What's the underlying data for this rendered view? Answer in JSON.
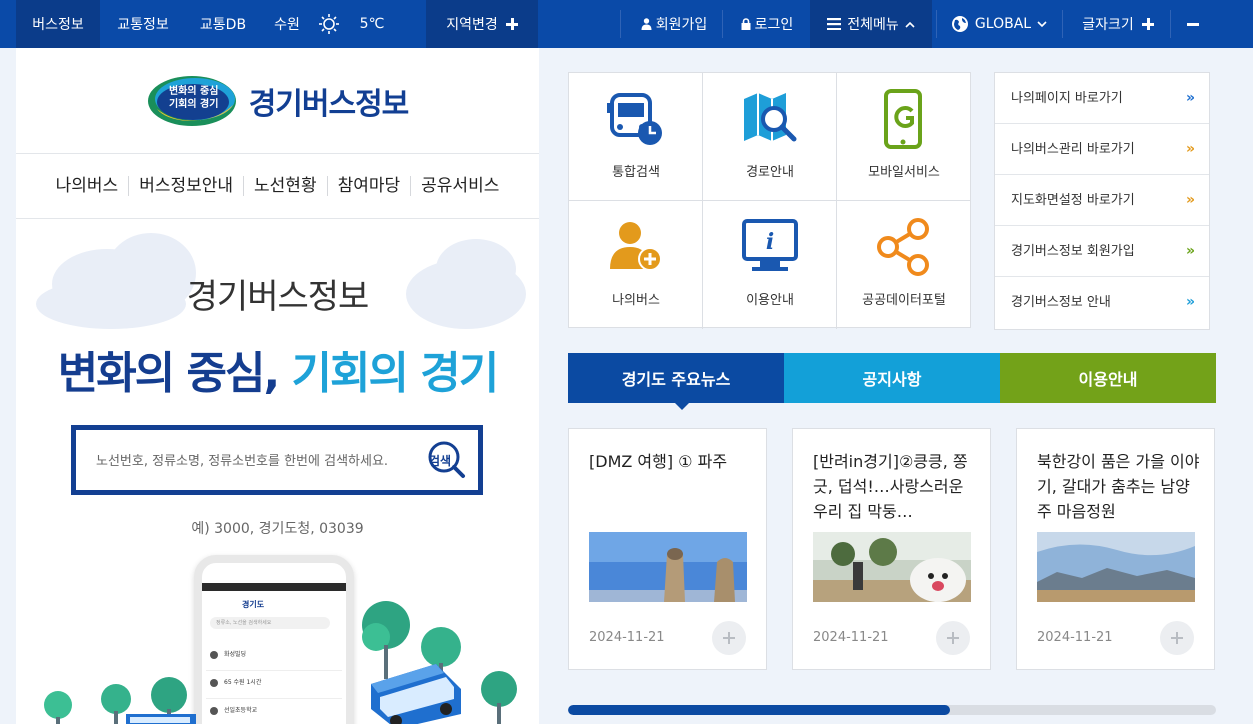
{
  "topbar": {
    "bus_info": "버스정보",
    "traffic_info": "교통정보",
    "traffic_db": "교통DB",
    "city": "수원",
    "weather_icon": "sun-icon",
    "temperature": "5℃",
    "region_change": "지역변경",
    "join": "회원가입",
    "login": "로그인",
    "all_menu": "전체메뉴",
    "global": "GLOBAL",
    "font_size": "글자크기"
  },
  "logo": {
    "badge_line1": "변화의 중심",
    "badge_line2": "기회의 경기",
    "title": "경기버스정보"
  },
  "gnb": [
    "나의버스",
    "버스정보안내",
    "노선현황",
    "참여마당",
    "공유서비스"
  ],
  "hero": {
    "subtitle": "경기버스정보",
    "title_part1": "변화의 중심,",
    "title_part2": "기회의 경기",
    "search_placeholder": "노선번호, 정류소명, 정류소번호를 한번에 검색하세요.",
    "search_button": "검색",
    "example": "예) 3000, 경기도청, 03039"
  },
  "phone": {
    "title": "경기도",
    "search": "정류소, 노선을 검색하세요",
    "rows": [
      "화성빌딩",
      "65   수원  1시간",
      "선일초등학교"
    ]
  },
  "quick_menu": [
    {
      "label": "통합검색",
      "icon": "bus-clock-icon"
    },
    {
      "label": "경로안내",
      "icon": "map-search-icon"
    },
    {
      "label": "모바일서비스",
      "icon": "mobile-icon"
    },
    {
      "label": "나의버스",
      "icon": "user-add-icon"
    },
    {
      "label": "이용안내",
      "icon": "monitor-info-icon"
    },
    {
      "label": "공공데이터포털",
      "icon": "share-icon"
    }
  ],
  "shortcuts": [
    {
      "label": "나의페이지 바로가기",
      "color": "#1e6fd0"
    },
    {
      "label": "나의버스관리 바로가기",
      "color": "#e39a1c"
    },
    {
      "label": "지도화면설정 바로가기",
      "color": "#e39a1c"
    },
    {
      "label": "경기버스정보 회원가입",
      "color": "#6aa31a"
    },
    {
      "label": "경기버스정보 안내",
      "color": "#1e9ed8"
    }
  ],
  "tabs": [
    "경기도 주요뉴스",
    "공지사항",
    "이용안내"
  ],
  "news": [
    {
      "title": "[DMZ 여행] ① 파주",
      "date": "2024-11-21"
    },
    {
      "title": "[반려in경기]②킁킁, 쫑긋, 덥석!…사랑스러운 우리 집 막둥…",
      "date": "2024-11-21"
    },
    {
      "title": "북한강이 품은 가을 이야기, 갈대가 춤추는 남양주 마음정원",
      "date": "2024-11-21"
    }
  ],
  "slider_progress": 0.59,
  "colors": {
    "primary": "#0a4aa8",
    "notice": "#13a0d8",
    "guide": "#73a219",
    "accent_orange": "#e39a1c"
  }
}
